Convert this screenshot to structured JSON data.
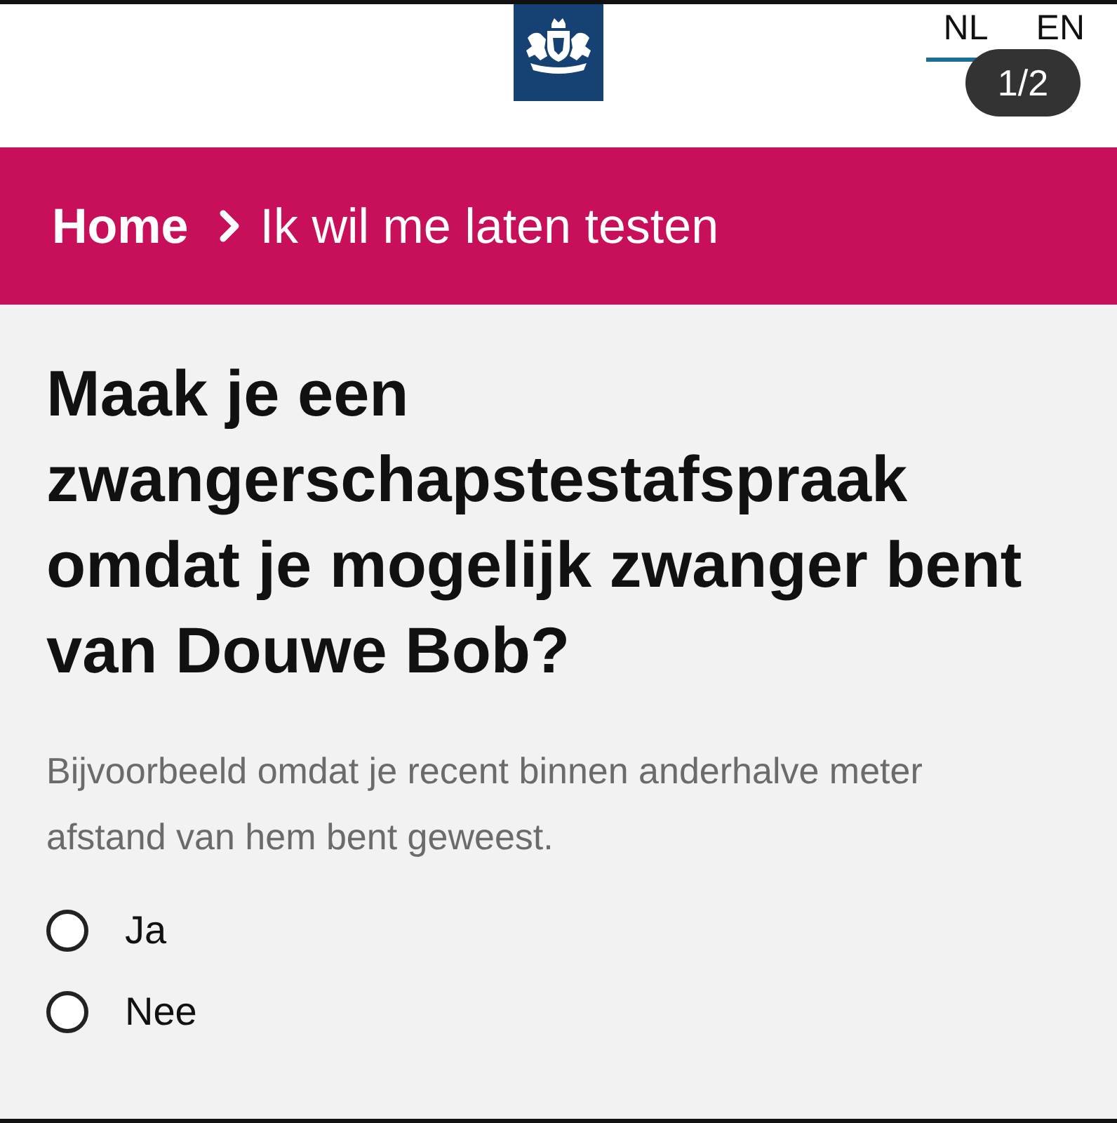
{
  "header": {
    "languages": [
      {
        "label": "NL",
        "selected": true
      },
      {
        "label": "EN",
        "selected": false
      }
    ]
  },
  "image_counter": {
    "text": "1/2"
  },
  "breadcrumb": [
    {
      "label": "Home",
      "kind": "link"
    },
    {
      "label": "Ik wil me laten testen",
      "kind": "current"
    }
  ],
  "question": {
    "title": "Maak je een zwangerschapstestafspraak omdat je mogelijk zwanger bent van Douwe Bob?",
    "hint": "Bijvoorbeeld omdat je recent binnen anderhalve meter afstand van hem bent geweest."
  },
  "options": [
    {
      "label": "Ja",
      "selected": false
    },
    {
      "label": "Nee",
      "selected": false
    }
  ]
}
